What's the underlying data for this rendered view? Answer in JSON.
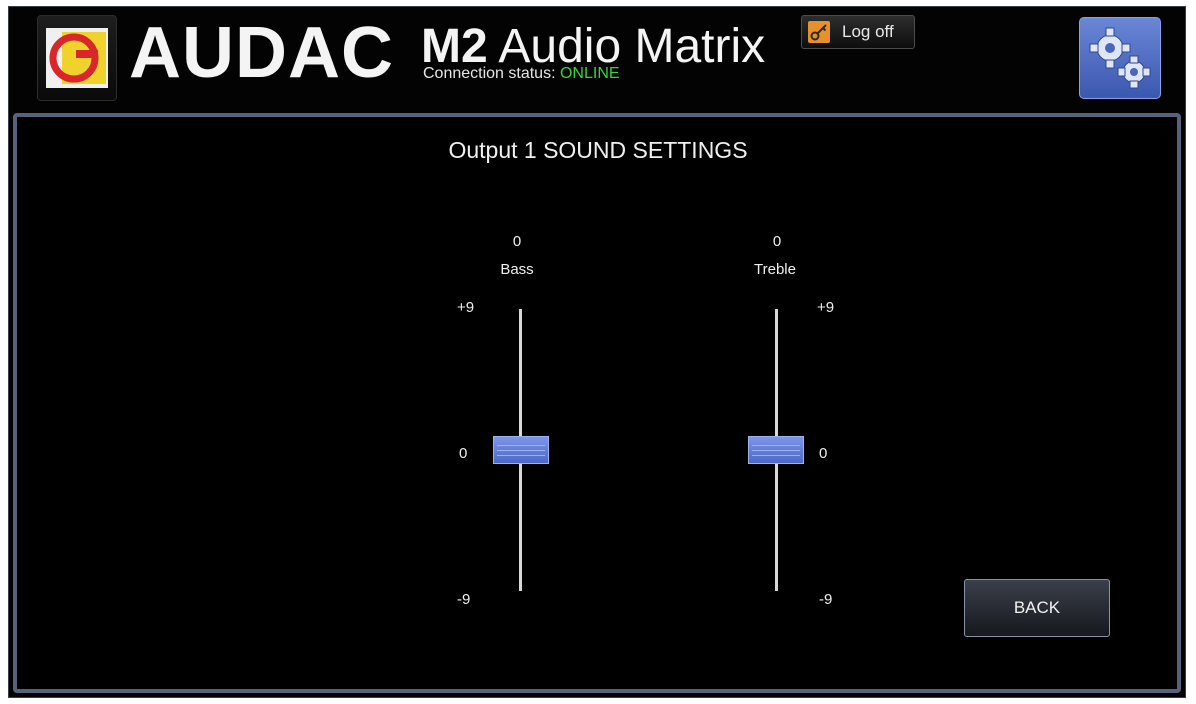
{
  "header": {
    "brand": "AUDAC",
    "product_model": "M2",
    "product_name": "Audio Matrix",
    "connection_label": "Connection status:",
    "connection_status": "ONLINE",
    "logoff_label": "Log off"
  },
  "page": {
    "title": "Output 1 SOUND SETTINGS"
  },
  "sliders": [
    {
      "name": "Bass",
      "value_text": "0",
      "value": 0,
      "min_label": "-9",
      "mid_label": "0",
      "max_label": "+9"
    },
    {
      "name": "Treble",
      "value_text": "0",
      "value": 0,
      "min_label": "-9",
      "mid_label": "0",
      "max_label": "+9"
    }
  ],
  "buttons": {
    "back": "BACK"
  },
  "colors": {
    "background": "#030303",
    "status_online": "#36d43a",
    "slider_thumb": "#6680dc",
    "accent_orange": "#e8902a"
  },
  "icons": {
    "logo": "audac-logo-icon",
    "logoff": "key-icon",
    "settings": "gears-icon"
  }
}
